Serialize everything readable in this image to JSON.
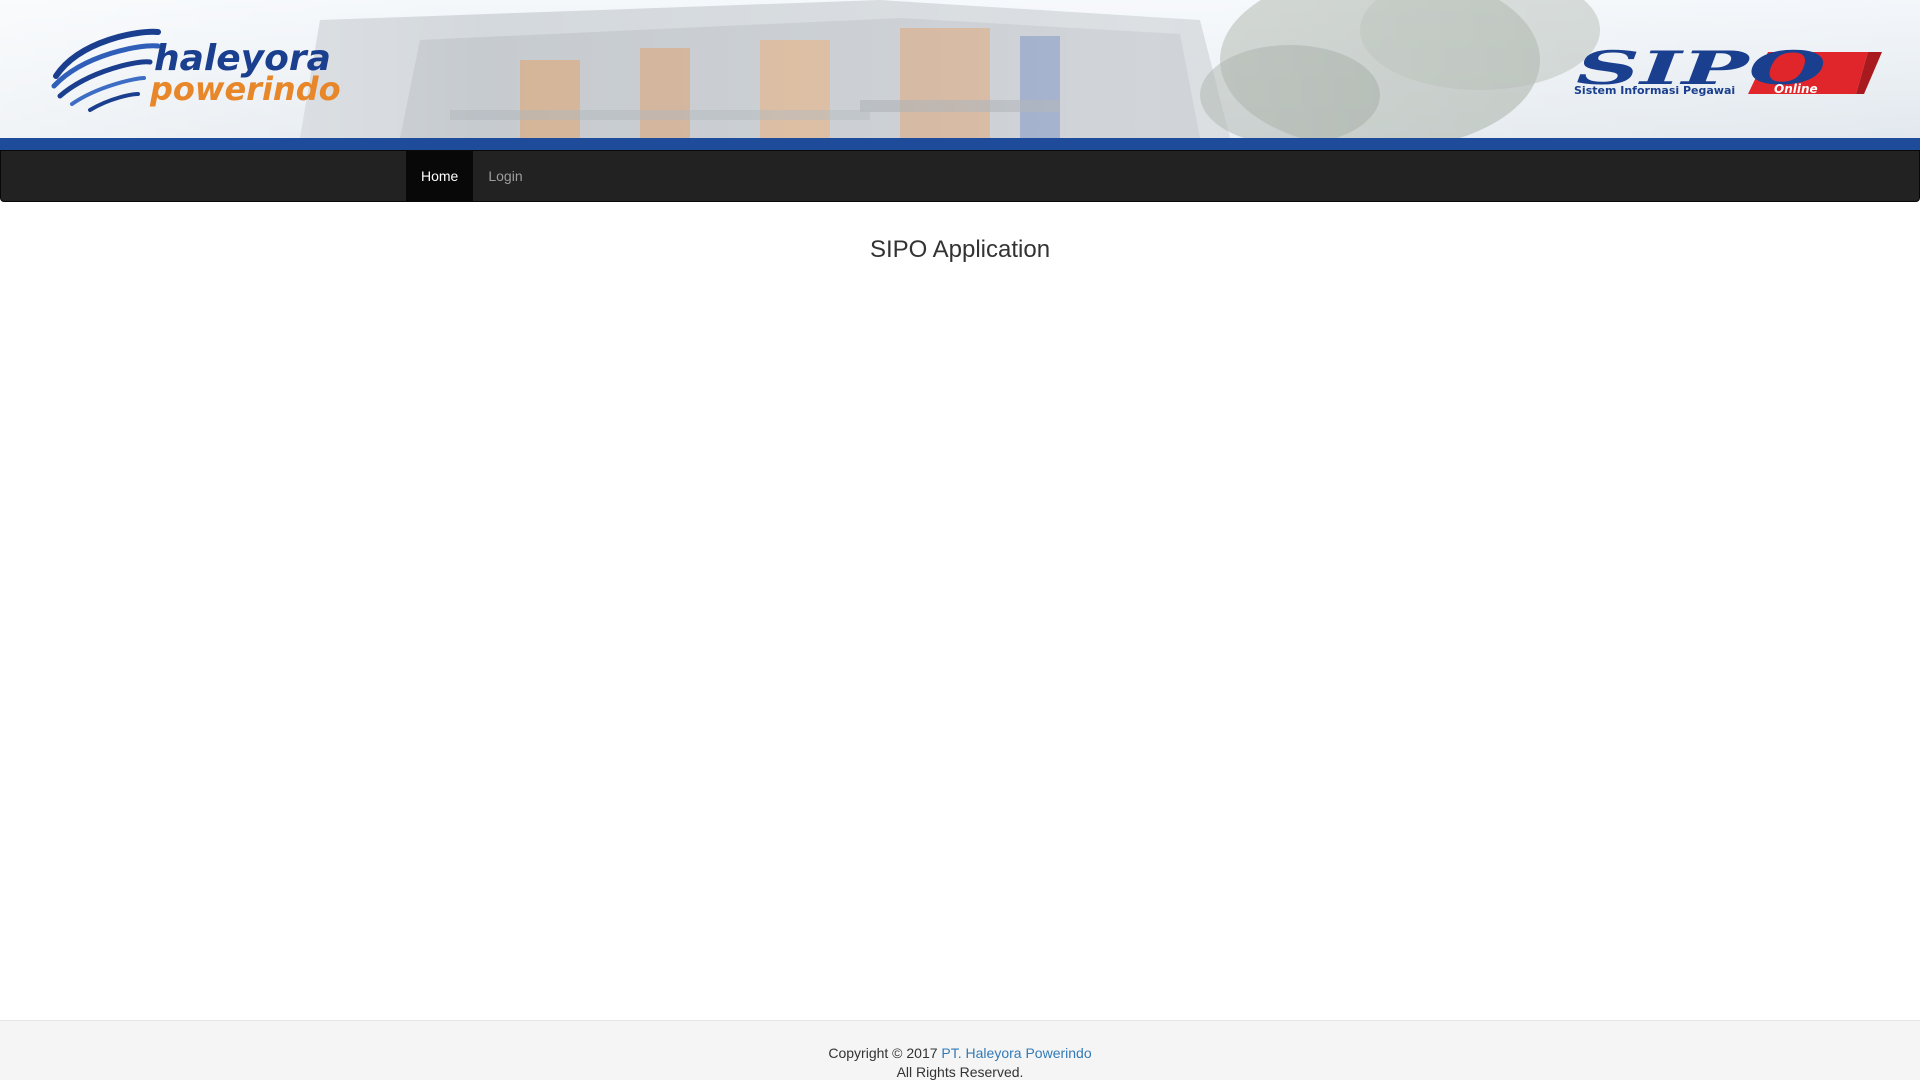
{
  "banner": {
    "company_logo_line1": "haleyora",
    "company_logo_line2": "powerindo",
    "app_logo_text": "SIPO",
    "app_logo_tagline": "Sistem Informasi Pegawai",
    "app_logo_badge": "Online",
    "colors": {
      "stripe": "#1f4c9a",
      "logo_blue": "#1b3f8f",
      "logo_orange": "#e8862a",
      "sipo_red": "#e0262b"
    }
  },
  "navbar": {
    "items": [
      {
        "label": "Home",
        "active": true
      },
      {
        "label": "Login",
        "active": false
      }
    ]
  },
  "main": {
    "title": "SIPO Application"
  },
  "footer": {
    "copyright_prefix": "Copyright © 2017 ",
    "company_link": "PT. Haleyora Powerindo",
    "rights": "All Rights Reserved."
  }
}
